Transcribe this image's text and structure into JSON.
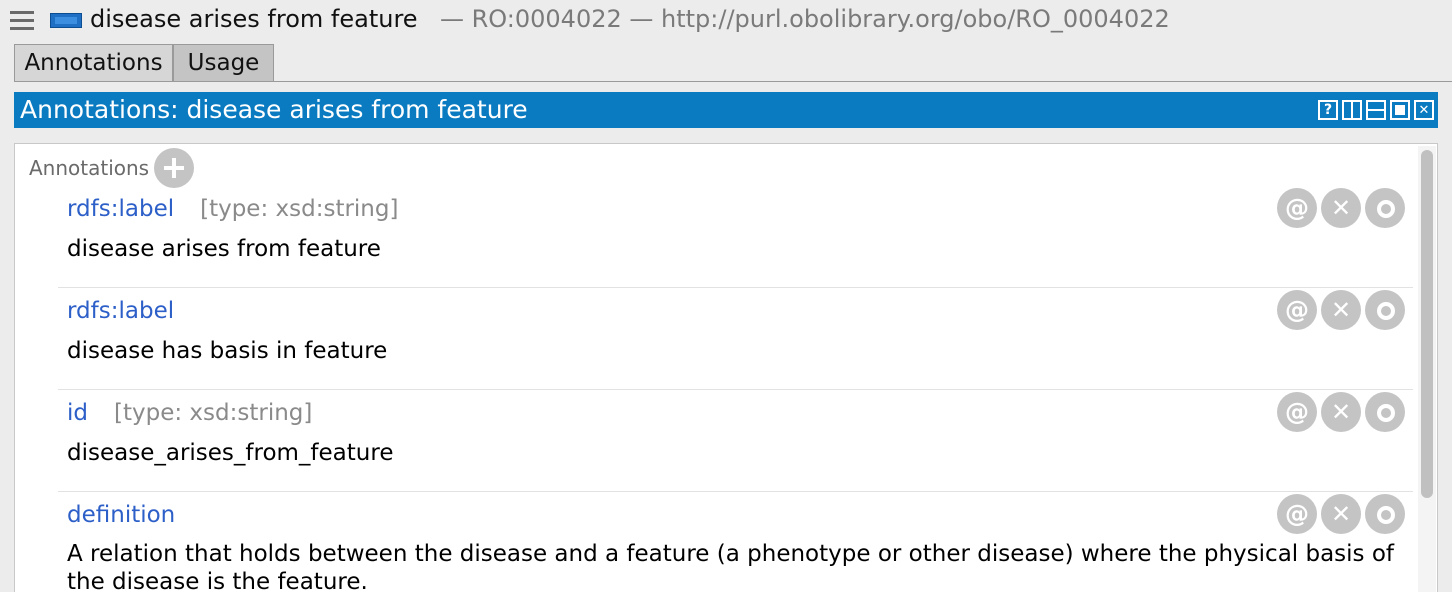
{
  "titlebar": {
    "entity_name": "disease arises from feature",
    "details": "— RO:0004022 — http://purl.obolibrary.org/obo/RO_0004022"
  },
  "tabs": [
    {
      "label": "Annotations",
      "active": true
    },
    {
      "label": "Usage",
      "active": false
    }
  ],
  "view": {
    "title": "Annotations: disease arises from feature",
    "buttons": [
      "help-icon",
      "split-vertical-icon",
      "split-horizontal-icon",
      "maximize-icon",
      "close-icon"
    ],
    "help_glyph": "?",
    "close_glyph": "✕"
  },
  "annotations": {
    "section_label": "Annotations",
    "items": [
      {
        "property": "rdfs:label",
        "type": "[type: xsd:string]",
        "value": "disease arises from feature"
      },
      {
        "property": "rdfs:label",
        "type": "",
        "value": "disease has basis in feature"
      },
      {
        "property": "id",
        "type": "[type: xsd:string]",
        "value": "disease_arises_from_feature"
      },
      {
        "property": "definition",
        "type": "",
        "value": "A relation that holds between the disease and a feature (a phenotype or other disease) where the physical basis of the disease is the feature."
      }
    ],
    "row_button_glyphs": {
      "annotate": "@",
      "delete": "✕"
    }
  },
  "colors": {
    "header_bg": "#0b7bc1",
    "property_text": "#2d5fc8",
    "button_grey": "#c4c4c4"
  }
}
